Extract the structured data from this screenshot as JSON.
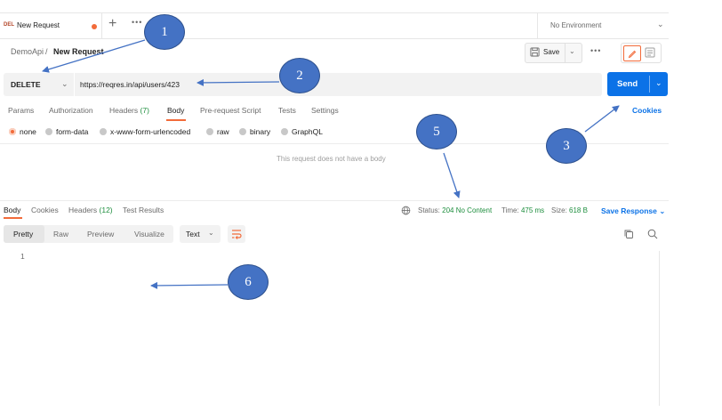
{
  "tabs": {
    "method_badge": "DEL",
    "active_title": "New Request",
    "add_glyph": "+",
    "more_glyph": "•••",
    "environment": "No Environment"
  },
  "breadcrumb": {
    "root": "DemoApi",
    "separator": "/",
    "current": "New Request"
  },
  "actions": {
    "save_label": "Save",
    "more_glyph": "•••"
  },
  "request": {
    "method": "DELETE",
    "url": "https://reqres.in/api/users/423",
    "send_label": "Send",
    "tabs": [
      {
        "label": "Params"
      },
      {
        "label": "Authorization"
      },
      {
        "label": "Headers",
        "count": "(7)"
      },
      {
        "label": "Body"
      },
      {
        "label": "Pre-request Script"
      },
      {
        "label": "Tests"
      },
      {
        "label": "Settings"
      }
    ],
    "active_tab": "Body",
    "cookies_label": "Cookies",
    "body_types": [
      "none",
      "form-data",
      "x-www-form-urlencoded",
      "raw",
      "binary",
      "GraphQL"
    ],
    "selected_body_type": "none",
    "empty_body_message": "This request does not have a body"
  },
  "response": {
    "tabs": [
      {
        "label": "Body"
      },
      {
        "label": "Cookies"
      },
      {
        "label": "Headers",
        "count": "(12)"
      },
      {
        "label": "Test Results"
      }
    ],
    "active_tab": "Body",
    "status_label": "Status:",
    "status_value": "204 No Content",
    "time_label": "Time:",
    "time_value": "475 ms",
    "size_label": "Size:",
    "size_value": "618 B",
    "save_response_label": "Save Response",
    "view_modes": [
      "Pretty",
      "Raw",
      "Preview",
      "Visualize"
    ],
    "active_view_mode": "Pretty",
    "format": "Text",
    "line_numbers": [
      "1"
    ]
  },
  "callouts": [
    "1",
    "2",
    "3",
    "5",
    "6"
  ],
  "colors": {
    "accent_orange": "#f26b3a",
    "send_blue": "#0b72e7",
    "callout_blue": "#4472c4",
    "status_green": "#1e8e3e"
  },
  "icons": [
    "plus-icon",
    "more-icon",
    "chevron-down-icon",
    "save-icon",
    "pencil-icon",
    "document-icon",
    "globe-icon",
    "wrap-icon",
    "copy-icon",
    "search-icon"
  ]
}
